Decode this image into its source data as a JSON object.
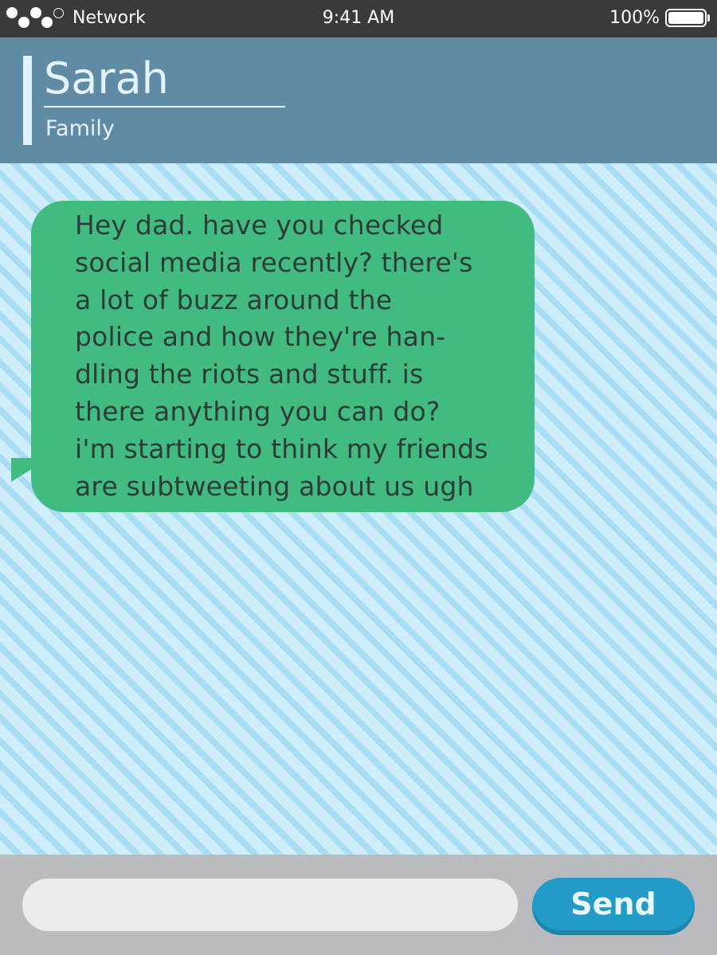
{
  "status_bar": {
    "network_label": "Network",
    "time": "9:41 AM",
    "battery_percent": "100%",
    "signal_icon": "signal-dots-icon",
    "battery_icon": "battery-full-icon"
  },
  "contact": {
    "name": "Sarah",
    "group": "Family"
  },
  "conversation": {
    "messages": [
      {
        "direction": "incoming",
        "text": "Hey dad. have you checked\nsocial media recently? there's\na lot of buzz around the\npolice and how they're han-\ndling the riots and stuff. is\nthere anything you can do?\ni'm starting to think my friends\nare subtweeting about us ugh"
      }
    ]
  },
  "composer": {
    "input_value": "",
    "input_placeholder": "",
    "send_label": "Send"
  },
  "colors": {
    "status_bar": "#3a393b",
    "header": "#5f8ca4",
    "header_text": "#e4f2fb",
    "stripe_light": "#cfeefc",
    "stripe_dark": "#a8ddf4",
    "bubble": "#41bb80",
    "bubble_text": "#2d3c38",
    "composer_bar": "#babbbf",
    "input_bg": "#ebebeb",
    "send_button": "#229bc6"
  }
}
